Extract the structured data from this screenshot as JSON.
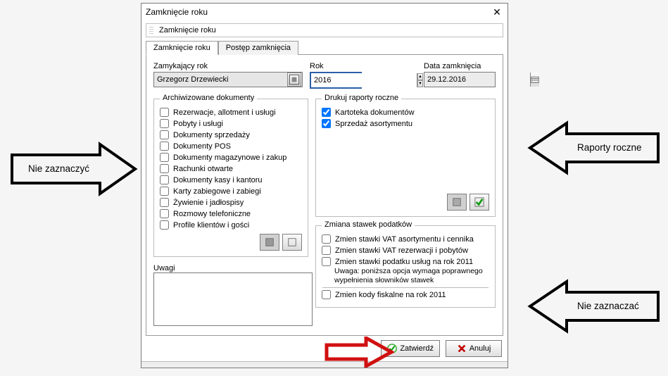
{
  "window": {
    "title": "Zamknięcie roku",
    "subtitle": "Zamknięcie roku",
    "close_glyph": "✕"
  },
  "tabs": {
    "t1": "Zamknięcie roku",
    "t2": "Postęp zamknięcia"
  },
  "top": {
    "user_label": "Zamykający rok",
    "user_value": "Grzegorz Drzewiecki",
    "year_label": "Rok",
    "year_value": "2016",
    "date_label": "Data zamknięcia",
    "date_value": "29.12.2016"
  },
  "arch": {
    "legend": "Archiwizowane dokumenty",
    "items": [
      "Rezerwacje,  allotment i usługi",
      "Pobyty i usługi",
      "Dokumenty sprzedaży",
      "Dokumenty POS",
      "Dokumenty magazynowe i zakup",
      "Rachunki otwarte",
      "Dokumenty kasy i kantoru",
      "Karty zabiegowe i zabiegi",
      "Żywienie i jadłospisy",
      "Rozmowy telefoniczne",
      "Profile klientów i gości"
    ]
  },
  "reports": {
    "legend": "Drukuj raporty roczne",
    "items": [
      {
        "label": "Kartoteka dokumentów",
        "checked": true
      },
      {
        "label": "Sprzedaż asortymentu",
        "checked": true
      }
    ]
  },
  "taxes": {
    "legend": "Zmiana stawek podatków",
    "c1": "Zmien stawki VAT asortymentu i cennika",
    "c2": "Zmien stawki VAT rezerwacji i pobytów",
    "c3": "Zmien stawki podatku usług na rok 2011",
    "note": "Uwaga: poniższa opcja wymaga poprawnego wypełnienia słowników stawek",
    "c4": "Zmien kody fiskalne na rok 2011"
  },
  "uwagi_label": "Uwagi",
  "uwagi_value": "",
  "buttons": {
    "ok": "Zatwierdź",
    "cancel": "Anuluj"
  },
  "callouts": {
    "left": "Nie zaznaczyć",
    "right_top": "Raporty roczne",
    "right_bottom": "Nie zaznaczać"
  },
  "chart_data": null
}
